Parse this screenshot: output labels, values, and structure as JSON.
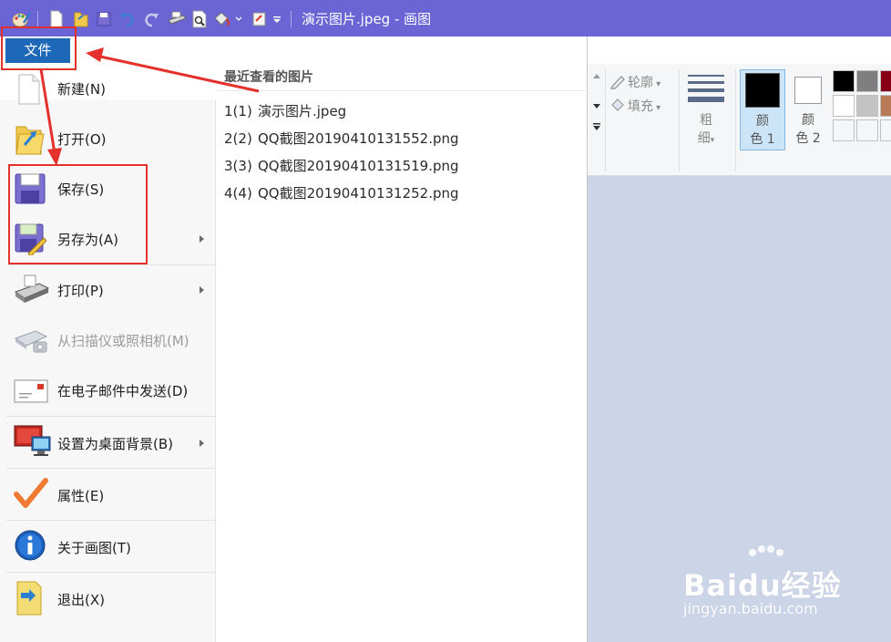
{
  "titlebar": {
    "title": "演示图片.jpeg - 画图",
    "quick_access": [
      "paint-app-icon",
      "new-icon",
      "open-icon",
      "save-icon",
      "undo-icon",
      "redo-icon",
      "print-icon",
      "print-preview-icon",
      "paint-bucket-icon",
      "crop-icon",
      "customize-dropdown-icon"
    ],
    "background": "#6a64d4"
  },
  "file_tab": {
    "label": "文件",
    "color": "#1d69b8"
  },
  "menu": {
    "items": [
      {
        "label": "新建(N)",
        "icon": "new-file-icon",
        "enabled": true,
        "submenu": false
      },
      {
        "label": "打开(O)",
        "icon": "open-folder-icon",
        "enabled": true,
        "submenu": false
      },
      {
        "label": "保存(S)",
        "icon": "save-icon",
        "enabled": true,
        "submenu": false
      },
      {
        "label": "另存为(A)",
        "icon": "save-as-icon",
        "enabled": true,
        "submenu": true
      },
      {
        "label": "打印(P)",
        "icon": "printer-icon",
        "enabled": true,
        "submenu": true
      },
      {
        "label": "从扫描仪或照相机(M)",
        "icon": "scanner-icon",
        "enabled": false,
        "submenu": false
      },
      {
        "label": "在电子邮件中发送(D)",
        "icon": "email-icon",
        "enabled": true,
        "submenu": false
      },
      {
        "label": "设置为桌面背景(B)",
        "icon": "desktop-background-icon",
        "enabled": true,
        "submenu": true
      },
      {
        "label": "属性(E)",
        "icon": "checkmark-icon",
        "enabled": true,
        "submenu": false
      },
      {
        "label": "关于画图(T)",
        "icon": "info-icon",
        "enabled": true,
        "submenu": false
      },
      {
        "label": "退出(X)",
        "icon": "exit-icon",
        "enabled": true,
        "submenu": false
      }
    ]
  },
  "recent": {
    "title": "最近查看的图片",
    "items": [
      {
        "num": "1(1)",
        "name": "演示图片.jpeg"
      },
      {
        "num": "2(2)",
        "name": "QQ截图20190410131552.png"
      },
      {
        "num": "3(3)",
        "name": "QQ截图20190410131519.png"
      },
      {
        "num": "4(4)",
        "name": "QQ截图20190410131252.png"
      }
    ]
  },
  "ribbon": {
    "outline": "轮廓",
    "fill": "填充",
    "size_line1": "粗",
    "size_line2": "细",
    "color1_line1": "颜",
    "color1_line2": "色 1",
    "color2_line1": "颜",
    "color2_line2": "色 2",
    "color1_value": "#000000",
    "color2_value": "#ffffff",
    "palette": [
      "#000000",
      "#7f7f7f",
      "#880015",
      "#ffffff",
      "#c3c3c3",
      "#b97a57",
      "#f0f0f0",
      "#f0f0f0",
      "#f0f0f0"
    ]
  },
  "annotations": {
    "color": "#e5312b"
  },
  "watermark": {
    "brand": "Baidu经验",
    "url": "jingyan.baidu.com"
  }
}
